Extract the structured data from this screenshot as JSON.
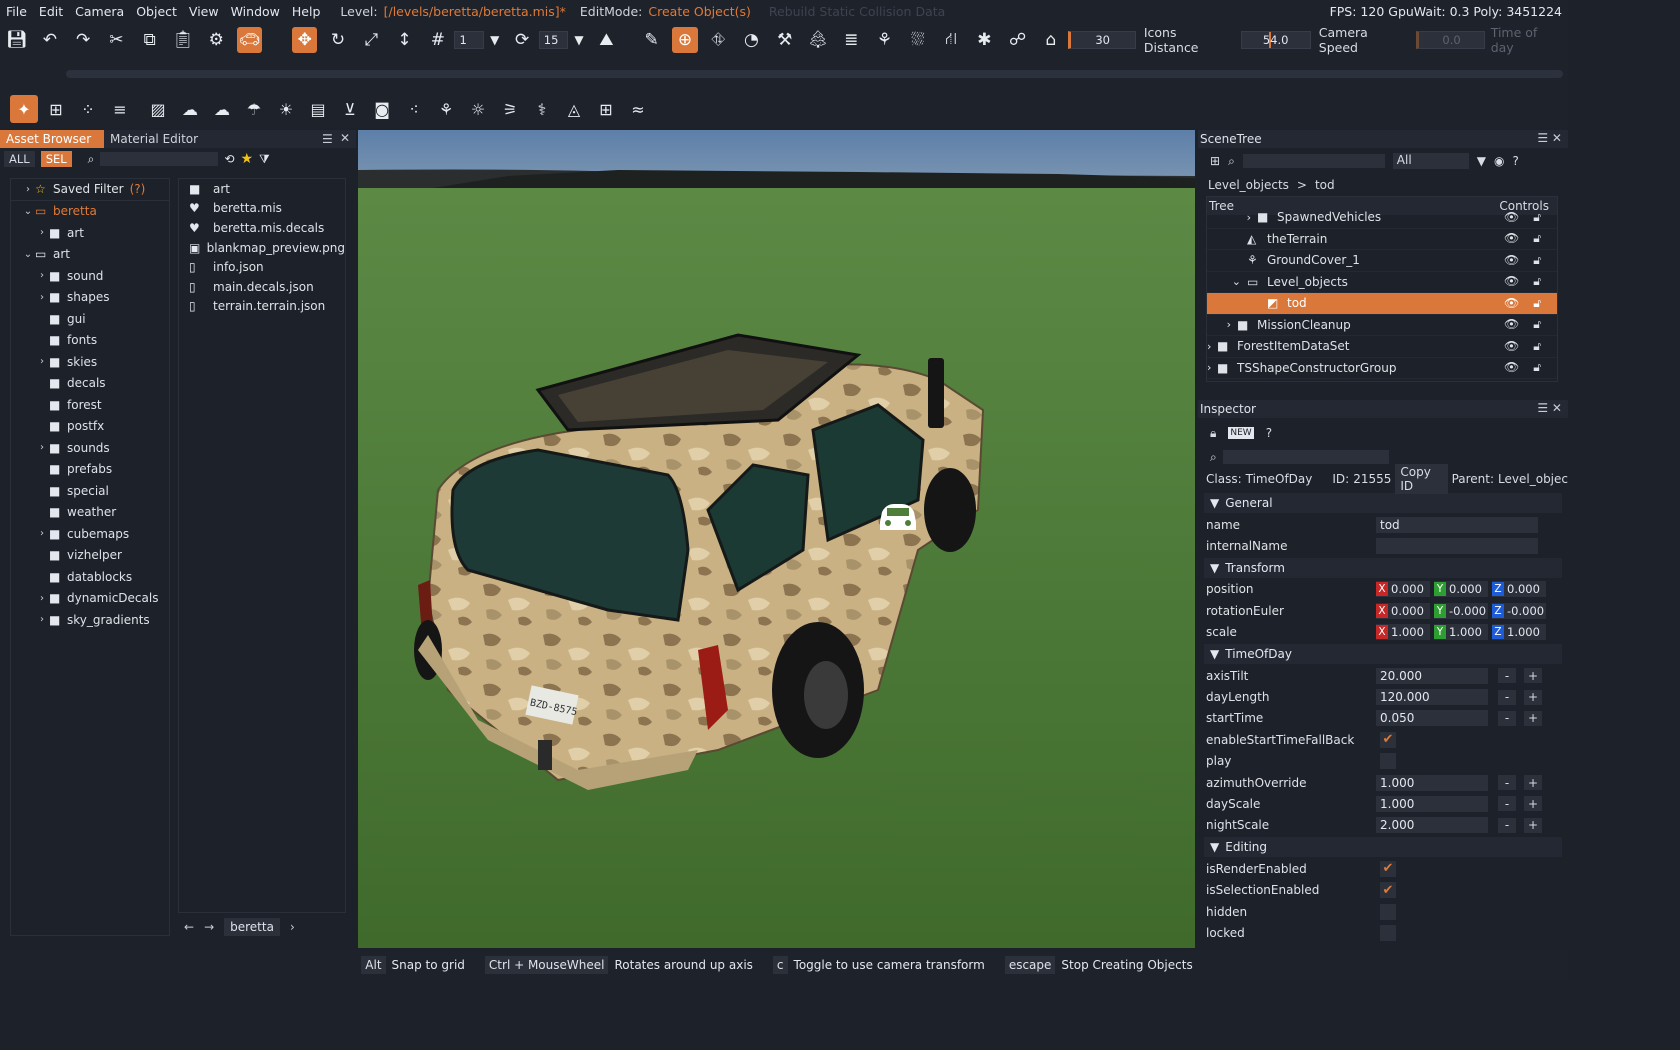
{
  "menubar": {
    "items": [
      "File",
      "Edit",
      "Camera",
      "Object",
      "View",
      "Window",
      "Help"
    ],
    "level_label": "Level:",
    "level_path": "[/levels/beretta/beretta.mis]*",
    "editmode_label": "EditMode:",
    "editmode_value": "Create Object(s)",
    "dim_text": "Rebuild Static Collision Data",
    "stats": "FPS: 120  GpuWait: 0.3  Poly: 3451224"
  },
  "toolbar": {
    "snap_value": "1",
    "rotate_snap_value": "15",
    "icons_distance_value": "30",
    "icons_distance_label": "Icons Distance",
    "camera_speed_value": "54.0",
    "camera_speed_label": "Camera Speed",
    "time_of_day_value": "0.0",
    "time_of_day_label": "Time of day"
  },
  "asset_browser": {
    "tabs": [
      "Asset Browser",
      "Material Editor"
    ],
    "filters": [
      "ALL",
      "SEL"
    ],
    "tree": [
      {
        "label": "Saved Filter",
        "extra": "(?)",
        "depth": 0,
        "exp": ">",
        "icon": "☆"
      },
      {
        "label": "beretta",
        "depth": 0,
        "exp": "v",
        "icon": "▭",
        "orange": true
      },
      {
        "label": "art",
        "depth": 1,
        "exp": ">",
        "icon": "■"
      },
      {
        "label": "art",
        "depth": 0,
        "exp": "v",
        "icon": "▭"
      },
      {
        "label": "sound",
        "depth": 1,
        "exp": ">",
        "icon": "■"
      },
      {
        "label": "shapes",
        "depth": 1,
        "exp": ">",
        "icon": "■"
      },
      {
        "label": "gui",
        "depth": 1,
        "exp": "",
        "icon": "■"
      },
      {
        "label": "fonts",
        "depth": 1,
        "exp": "",
        "icon": "■"
      },
      {
        "label": "skies",
        "depth": 1,
        "exp": ">",
        "icon": "■"
      },
      {
        "label": "decals",
        "depth": 1,
        "exp": "",
        "icon": "■"
      },
      {
        "label": "forest",
        "depth": 1,
        "exp": "",
        "icon": "■"
      },
      {
        "label": "postfx",
        "depth": 1,
        "exp": "",
        "icon": "■"
      },
      {
        "label": "sounds",
        "depth": 1,
        "exp": ">",
        "icon": "■"
      },
      {
        "label": "prefabs",
        "depth": 1,
        "exp": "",
        "icon": "■"
      },
      {
        "label": "special",
        "depth": 1,
        "exp": "",
        "icon": "■"
      },
      {
        "label": "weather",
        "depth": 1,
        "exp": "",
        "icon": "■"
      },
      {
        "label": "cubemaps",
        "depth": 1,
        "exp": ">",
        "icon": "■"
      },
      {
        "label": "vizhelper",
        "depth": 1,
        "exp": "",
        "icon": "■"
      },
      {
        "label": "datablocks",
        "depth": 1,
        "exp": "",
        "icon": "■"
      },
      {
        "label": "dynamicDecals",
        "depth": 1,
        "exp": ">",
        "icon": "■"
      },
      {
        "label": "sky_gradients",
        "depth": 1,
        "exp": ">",
        "icon": "■"
      }
    ],
    "files": [
      {
        "label": "art",
        "icon": "■"
      },
      {
        "label": "beretta.mis",
        "icon": "♥"
      },
      {
        "label": "beretta.mis.decals",
        "icon": "♥"
      },
      {
        "label": "blankmap_preview.png",
        "icon": "▣"
      },
      {
        "label": "info.json",
        "icon": "▯"
      },
      {
        "label": "main.decals.json",
        "icon": "▯"
      },
      {
        "label": "terrain.terrain.json",
        "icon": "▯"
      }
    ],
    "crumb": "beretta"
  },
  "viewport": {
    "plate": "BZD-8575"
  },
  "scenetree": {
    "title": "SceneTree",
    "filter_value": "All",
    "breadcrumb_root": "Level_objects",
    "breadcrumb_sep": ">",
    "breadcrumb_leaf": "tod",
    "col_tree": "Tree",
    "col_controls": "Controls",
    "rows": [
      {
        "label": "SpawnedVehicles",
        "indent": 50,
        "exp": ">",
        "icon": "■"
      },
      {
        "label": "theTerrain",
        "indent": 40,
        "exp": "",
        "icon": "◭"
      },
      {
        "label": "GroundCover_1",
        "indent": 40,
        "exp": "",
        "icon": "⚘"
      },
      {
        "label": "Level_objects",
        "indent": 40,
        "exp": "v",
        "icon": "▭"
      },
      {
        "label": "tod",
        "indent": 60,
        "exp": "",
        "icon": "◩",
        "selected": true
      },
      {
        "label": "MissionCleanup",
        "indent": 30,
        "exp": ">",
        "icon": "■"
      },
      {
        "label": "ForestItemDataSet",
        "indent": 10,
        "exp": ">",
        "icon": "■"
      },
      {
        "label": "TSShapeConstructorGroup",
        "indent": 10,
        "exp": ">",
        "icon": "■"
      }
    ]
  },
  "inspector": {
    "title": "Inspector",
    "class_label": "Class:",
    "class_value": "TimeOfDay",
    "id_label": "ID:",
    "id_value": "21555",
    "copy_id": "Copy ID",
    "parent_label": "Parent:",
    "parent_value": "Level_objec",
    "sections": {
      "general": "General",
      "transform": "Transform",
      "timeofday": "TimeOfDay",
      "editing": "Editing"
    },
    "general": [
      {
        "name": "name",
        "value": "tod"
      },
      {
        "name": "internalName",
        "value": ""
      }
    ],
    "transform": [
      {
        "name": "position",
        "x": "0.000",
        "y": "0.000",
        "z": "0.000"
      },
      {
        "name": "rotationEuler",
        "x": "0.000",
        "y": "-0.000",
        "z": "-0.000"
      },
      {
        "name": "scale",
        "x": "1.000",
        "y": "1.000",
        "z": "1.000"
      }
    ],
    "timeofday": [
      {
        "name": "axisTilt",
        "value": "20.000",
        "stepper": true
      },
      {
        "name": "dayLength",
        "value": "120.000",
        "stepper": true
      },
      {
        "name": "startTime",
        "value": "0.050",
        "stepper": true
      },
      {
        "name": "enableStartTimeFallBack",
        "checked": true
      },
      {
        "name": "play",
        "checked": false
      },
      {
        "name": "azimuthOverride",
        "value": "1.000",
        "stepper": true
      },
      {
        "name": "dayScale",
        "value": "1.000",
        "stepper": true
      },
      {
        "name": "nightScale",
        "value": "2.000",
        "stepper": true
      }
    ],
    "editing": [
      {
        "name": "isRenderEnabled",
        "checked": true
      },
      {
        "name": "isSelectionEnabled",
        "checked": true
      },
      {
        "name": "hidden",
        "checked": false
      },
      {
        "name": "locked",
        "checked": false
      }
    ]
  },
  "statusbar": [
    {
      "key": "Alt",
      "text": "Snap to grid"
    },
    {
      "key": "Ctrl + MouseWheel",
      "text": "Rotates around up axis"
    },
    {
      "key": "c",
      "text": "Toggle to use camera transform"
    },
    {
      "key": "escape",
      "text": "Stop Creating Objects"
    }
  ],
  "colors": {
    "accent": "#d9783a",
    "bg": "#1d2129",
    "panel": "#232832"
  }
}
